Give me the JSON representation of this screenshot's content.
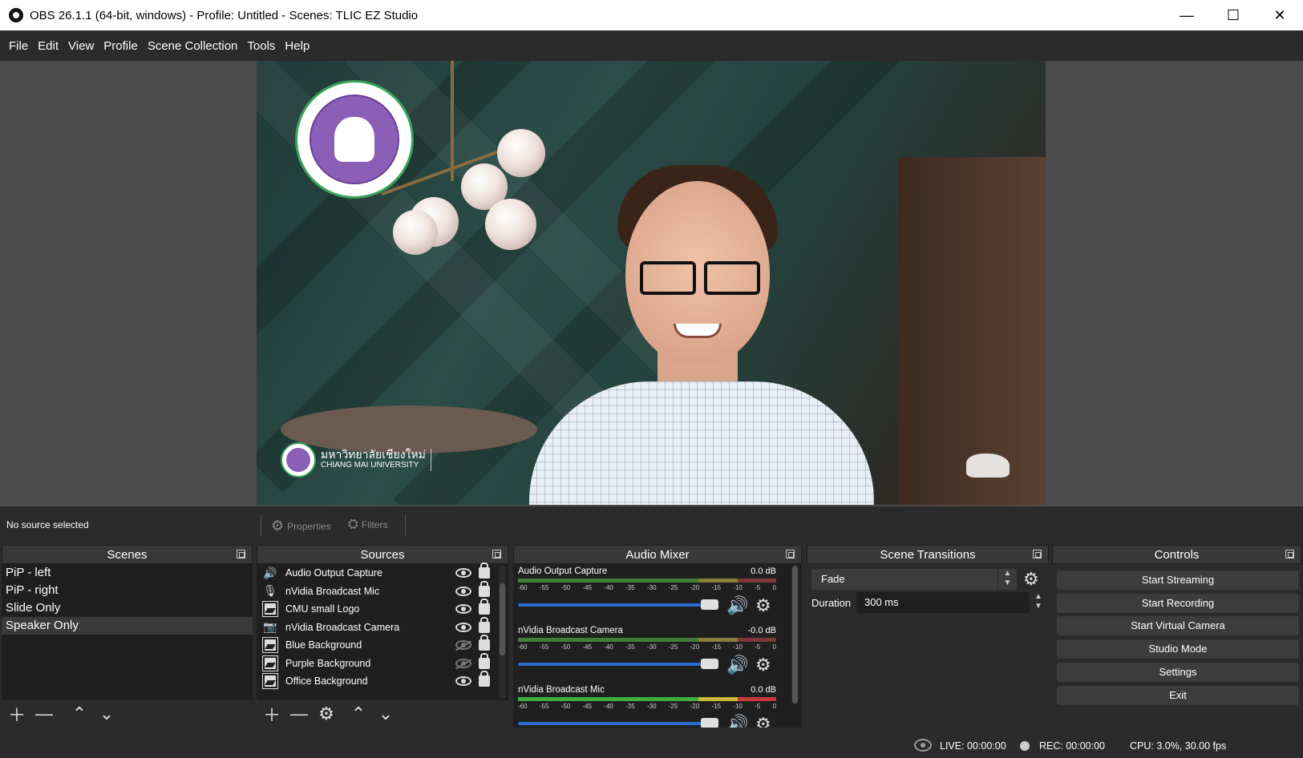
{
  "window": {
    "title": "OBS 26.1.1 (64-bit, windows) - Profile: Untitled - Scenes: TLIC EZ Studio",
    "minimize": "—",
    "maximize": "☐",
    "close": "✕"
  },
  "menu": [
    "File",
    "Edit",
    "View",
    "Profile",
    "Scene Collection",
    "Tools",
    "Help"
  ],
  "preview": {
    "logo_text": "มหาวิทยาลัยเชียงใหม่",
    "logo_subtext": "CHIANG MAI UNIVERSITY"
  },
  "source_toolbar": {
    "status": "No source selected",
    "properties": "Properties",
    "filters": "Filters"
  },
  "scenes": {
    "title": "Scenes",
    "items": [
      "PiP - left",
      "PiP - right",
      "Slide Only",
      "Speaker Only"
    ],
    "selected": "Speaker Only"
  },
  "sources": {
    "title": "Sources",
    "items": [
      {
        "name": "Audio Output Capture",
        "icon": "speaker-icon",
        "visible": true
      },
      {
        "name": "nVidia Broadcast Mic",
        "icon": "mic-icon",
        "visible": true
      },
      {
        "name": "CMU small Logo",
        "icon": "image-icon",
        "visible": true
      },
      {
        "name": "nVidia Broadcast Camera",
        "icon": "camera-icon",
        "visible": true
      },
      {
        "name": "Blue Background",
        "icon": "image-icon",
        "visible": false
      },
      {
        "name": "Purple Background",
        "icon": "image-icon",
        "visible": false
      },
      {
        "name": "Office Background",
        "icon": "image-icon",
        "visible": true
      }
    ]
  },
  "audio_mixer": {
    "title": "Audio Mixer",
    "ticks": [
      "-60",
      "-55",
      "-50",
      "-45",
      "-40",
      "-35",
      "-30",
      "-25",
      "-20",
      "-15",
      "-10",
      "-5",
      "0"
    ],
    "channels": [
      {
        "name": "Audio Output Capture",
        "db": "0.0 dB"
      },
      {
        "name": "nVidia Broadcast Camera",
        "db": "-0.0 dB"
      },
      {
        "name": "nVidia Broadcast Mic",
        "db": "0.0 dB"
      }
    ]
  },
  "transitions": {
    "title": "Scene Transitions",
    "selected": "Fade",
    "duration_label": "Duration",
    "duration_value": "300 ms"
  },
  "controls": {
    "title": "Controls",
    "buttons": [
      "Start Streaming",
      "Start Recording",
      "Start Virtual Camera",
      "Studio Mode",
      "Settings",
      "Exit"
    ]
  },
  "status": {
    "live": "LIVE: 00:00:00",
    "rec": "REC: 00:00:00",
    "cpu": "CPU: 3.0%, 30.00 fps"
  }
}
